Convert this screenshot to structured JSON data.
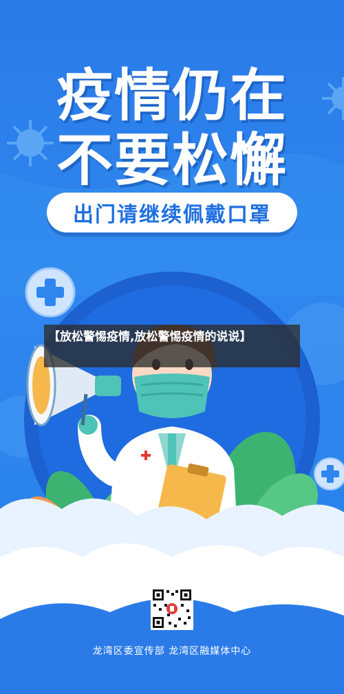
{
  "poster": {
    "title_line1": "疫情仍在",
    "title_line2": "不要松懈",
    "subtitle": "出门请继续佩戴口罩",
    "footer": "龙湾区委宣传部 龙湾区融媒体中心"
  },
  "overlay": {
    "caption": "【放松警惕疫情,放松警惕疫情的说说】"
  },
  "icons": [
    "virus-icon",
    "medical-cross-icon",
    "megaphone-icon",
    "qr-code"
  ],
  "colors": {
    "background": "#2a7be8",
    "accent_dark": "#1f6fe0",
    "cloud": "#e9f3ff",
    "mask": "#4fc3b7",
    "clipboard": "#f6b84b",
    "leaf": "#3cb371"
  }
}
